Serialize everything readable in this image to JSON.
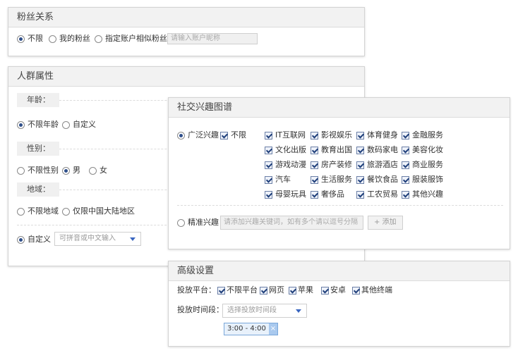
{
  "fans": {
    "title": "粉丝关系",
    "options": [
      {
        "label": "不限",
        "checked": true
      },
      {
        "label": "我的粉丝",
        "checked": false
      },
      {
        "label": "指定账户相似粉丝",
        "checked": false
      }
    ],
    "account_placeholder": "请输入账户昵称"
  },
  "crowd": {
    "title": "人群属性",
    "age": {
      "label": "年龄：",
      "options": [
        {
          "label": "不限年龄",
          "checked": true
        },
        {
          "label": "自定义",
          "checked": false
        }
      ]
    },
    "gender": {
      "label": "性别：",
      "options": [
        {
          "label": "不限性别",
          "checked": false
        },
        {
          "label": "男",
          "checked": true
        },
        {
          "label": "女",
          "checked": false
        }
      ]
    },
    "region": {
      "label": "地域：",
      "options": [
        {
          "label": "不限地域",
          "checked": false
        },
        {
          "label": "仅限中国大陆地区",
          "checked": false
        }
      ],
      "custom_label": "自定义",
      "custom_checked": true,
      "select_placeholder": "可拼音或中文输入"
    }
  },
  "social": {
    "title": "社交兴趣图谱",
    "broad_label": "广泛兴趣",
    "broad_checked": true,
    "unlimited_label": "不限",
    "interests": [
      "IT互联网",
      "影视娱乐",
      "体育健身",
      "金融服务",
      "文化出版",
      "教育出国",
      "数码家电",
      "美容化妆",
      "游戏动漫",
      "房产装修",
      "旅游酒店",
      "商业服务",
      "汽车",
      "生活服务",
      "餐饮食品",
      "服装服饰",
      "母婴玩具",
      "奢侈品",
      "工农贸易",
      "其他兴趣"
    ],
    "precise_label": "精准兴趣",
    "keyword_placeholder": "请添加兴趣关键词，如有多个请以逗号分隔",
    "add_label": "+ 添加"
  },
  "advanced": {
    "title": "高级设置",
    "platform_label": "投放平台：",
    "platforms": [
      {
        "label": "不限平台",
        "checked": true
      },
      {
        "label": "网页",
        "checked": true
      },
      {
        "label": "苹果",
        "checked": true
      },
      {
        "label": "安卓",
        "checked": true
      },
      {
        "label": "其他终端",
        "checked": true
      }
    ],
    "time_label": "投放时间段：",
    "time_placeholder": "选择投放时间段",
    "selected_time": "3:00 - 4:00",
    "remove_symbol": "×"
  },
  "colors": {
    "accent": "#3a66c0",
    "tag_bg": "#e8f1fb"
  }
}
